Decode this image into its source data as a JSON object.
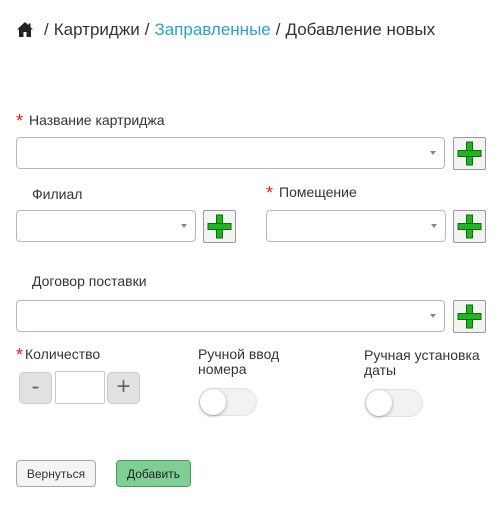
{
  "breadcrumb": {
    "home_icon": "home-icon",
    "separator": "/",
    "items": [
      "Картриджи",
      "Заправленные",
      "Добавление новых"
    ]
  },
  "form": {
    "required_mark": "*",
    "cartridge_name_label": "Название картриджа",
    "branch_label": "Филиал",
    "room_label": "Помещение",
    "contract_label": "Договор поставки",
    "quantity_label": "Количество",
    "manual_number_label": "Ручной ввод номера",
    "manual_date_label": "Ручная установка даты",
    "cartridge_name_value": "",
    "branch_value": "",
    "room_value": "",
    "contract_value": "",
    "quantity_value": "",
    "minus_label": "-",
    "plus_label": "+",
    "manual_number_on": false,
    "manual_date_on": false
  },
  "buttons": {
    "back_label": "Вернуться",
    "add_label": "Добавить"
  },
  "colors": {
    "link": "#2aa3c7",
    "required": "#e02020",
    "plus_green": "#1fb51f",
    "add_button": "#7fcf95"
  }
}
